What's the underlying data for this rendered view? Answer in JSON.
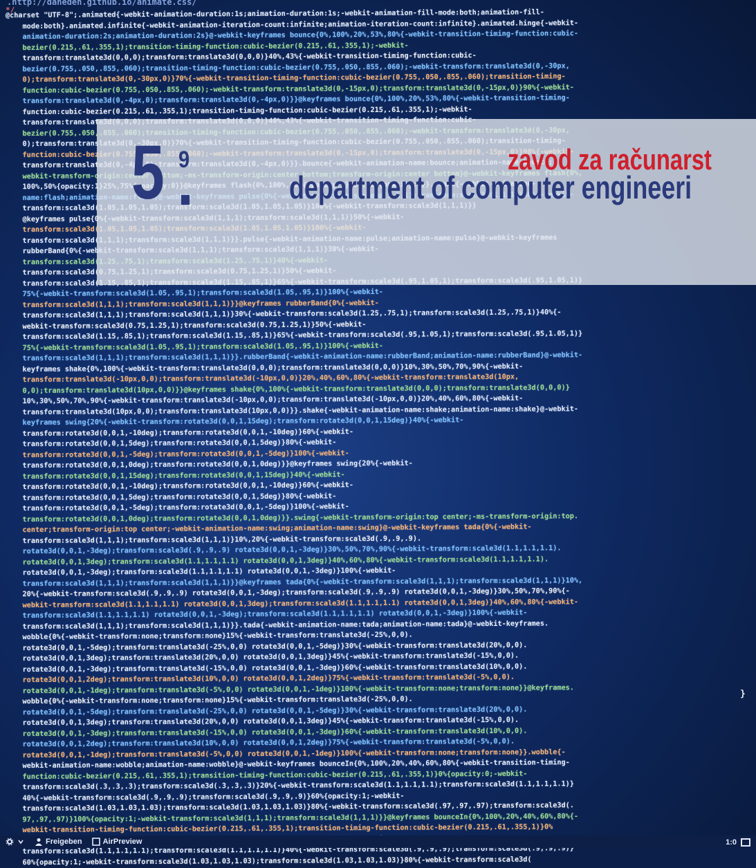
{
  "url_line": ".http://daneden.github.io/animate.css/",
  "comment_end": "*/",
  "code_lines": [
    "@charset \"UTF-8\";.animated{-webkit-animation-duration:1s;animation-duration:1s;-webkit-animation-fill-mode:both;animation-fill-",
    "    mode:both}.animated.infinite{-webkit-animation-iteration-count:infinite;animation-iteration-count:infinite}.animated.hinge{-webkit-",
    "    animation-duration:2s;animation-duration:2s}@-webkit-keyframes bounce{0%,100%,20%,53%,80%{-webkit-transition-timing-function:cubic-",
    "    bezier(0.215,.61,.355,1);transition-timing-function:cubic-bezier(0.215,.61,.355,1);-webkit-",
    "    transform:translate3d(0,0,0);transform:translate3d(0,0,0)}40%,43%{-webkit-transition-timing-function:cubic-",
    "    bezier(0.755,.050,.855,.060);transition-timing-function:cubic-bezier(0.755,.050,.855,.060);-webkit-transform:translate3d(0,-30px,",
    "    0);transform:translate3d(0,-30px,0)}70%{-webkit-transition-timing-function:cubic-bezier(0.755,.050,.855,.060);transition-timing-",
    "    function:cubic-bezier(0.755,.050,.855,.060);-webkit-transform:translate3d(0,-15px,0);transform:translate3d(0,-15px,0)}90%{-webkit-",
    "    transform:translate3d(0,-4px,0);transform:translate3d(0,-4px,0)}}@keyframes bounce{0%,100%,20%,53%,80%{-webkit-transition-timing-",
    "    function:cubic-bezier(0.215,.61,.355,1);transition-timing-function:cubic-bezier(0.215,.61,.355,1);-webkit-",
    "    transform:translate3d(0,0,0);transform:translate3d(0,0,0)}40%,43%{-webkit-transition-timing-function:cubic-",
    "    bezier(0.755,.050,.855,.060);transition-timing-function:cubic-bezier(0.755,.050,.855,.060);-webkit-transform:translate3d(0,-30px,",
    "    0);transform:translate3d(0,-30px,0)}70%{-webkit-transition-timing-function:cubic-bezier(0.755,.050,.855,.060);transition-timing-",
    "    function:cubic-bezier(0.755,.050,.855,.060);-webkit-transform:translate3d(0,-15px,0);transform:translate3d(0,-15px,0)}90%{-webkit-",
    "    transform:translate3d(0,-4px,0);transform:translate3d(0,-4px,0)}}.bounce{-webkit-animation-name:bounce;animation-name:bounce;",
    "    webkit-transform-origin:center bottom;-ms-transform-origin:center bottom;transform-origin:center bottom}@-webkit-keyframes flash{0%,",
    "    100%,50%{opacity:1}25%,75%{opacity:0}}@keyframes flash{0%,100%,50%{opacity:1}25%,75%{opacity:0}}.flash{-webkit-animation-",
    "    name:flash;animation-name:flash}@-webkit-keyframes pulse{0%{-webkit-transform:scale3d(1,1,1);transform:scale3d(1,1,1)}50%{-webkit-",
    "    transform:scale3d(1.05,1.05,1.05);transform:scale3d(1.05,1.05,1.05)}100%{-webkit-transform:scale3d(1,1,1)}}",
    "    @keyframes pulse{0%{-webkit-transform:scale3d(1,1,1);transform:scale3d(1,1,1)}50%{-webkit-",
    "    transform:scale3d(1.05,1.05,1.05);transform:scale3d(1.05,1.05,1.05)}100%{-webkit-",
    "    transform:scale3d(1,1,1);transform:scale3d(1,1,1)}}.pulse{-webkit-animation-name:pulse;animation-name:pulse}@-webkit-keyframes",
    "    rubberBand{0%{-webkit-transform:scale3d(1,1,1);transform:scale3d(1,1,1)}30%{-webkit-",
    "    transform:scale3d(1.25,.75,1);transform:scale3d(1.25,.75,1)}40%{-webkit-",
    "    transform:scale3d(0.75,1.25,1);transform:scale3d(0.75,1.25,1)}50%{-webkit-",
    "    transform:scale3d(1.15,.85,1);transform:scale3d(1.15,.85,1)}65%{-webkit-transform:scale3d(.95,1.05,1);transform:scale3d(.95,1.05,1)}",
    "    75%{-webkit-transform:scale3d(1.05,.95,1);transform:scale3d(1.05,.95,1)}100%{-webkit-",
    "    transform:scale3d(1,1,1);transform:scale3d(1,1,1)}}@keyframes rubberBand{0%{-webkit-",
    "    transform:scale3d(1,1,1);transform:scale3d(1,1,1)}30%{-webkit-transform:scale3d(1.25,.75,1);transform:scale3d(1.25,.75,1)}40%{-",
    "    webkit-transform:scale3d(0.75,1.25,1);transform:scale3d(0.75,1.25,1)}50%{-webkit-",
    "    transform:scale3d(1.15,.85,1);transform:scale3d(1.15,.85,1)}65%{-webkit-transform:scale3d(.95,1.05,1);transform:scale3d(.95,1.05,1)}",
    "    75%{-webkit-transform:scale3d(1.05,.95,1);transform:scale3d(1.05,.95,1)}100%{-webkit-",
    "    transform:scale3d(1,1,1);transform:scale3d(1,1,1)}}.rubberBand{-webkit-animation-name:rubberBand;animation-name:rubberBand}@-webkit-",
    "    keyframes shake{0%,100%{-webkit-transform:translate3d(0,0,0);transform:translate3d(0,0,0)}10%,30%,50%,70%,90%{-webkit-",
    "    transform:translate3d(-10px,0,0);transform:translate3d(-10px,0,0)}20%,40%,60%,80%{-webkit-transform:translate3d(10px,",
    "    0,0);transform:translate3d(10px,0,0)}}@keyframes shake{0%,100%{-webkit-transform:translate3d(0,0,0);transform:translate3d(0,0,0)}",
    "    10%,30%,50%,70%,90%{-webkit-transform:translate3d(-10px,0,0);transform:translate3d(-10px,0,0)}20%,40%,60%,80%{-webkit-",
    "    transform:translate3d(10px,0,0);transform:translate3d(10px,0,0)}}.shake{-webkit-animation-name:shake;animation-name:shake}@-webkit-",
    "    keyframes swing{20%{-webkit-transform:rotate3d(0,0,1,15deg);transform:rotate3d(0,0,1,15deg)}40%{-webkit-",
    "    transform:rotate3d(0,0,1,-10deg);transform:rotate3d(0,0,1,-10deg)}60%{-webkit-",
    "    transform:rotate3d(0,0,1,5deg);transform:rotate3d(0,0,1,5deg)}80%{-webkit-",
    "    transform:rotate3d(0,0,1,-5deg);transform:rotate3d(0,0,1,-5deg)}100%{-webkit-",
    "    transform:rotate3d(0,0,1,0deg);transform:rotate3d(0,0,1,0deg)}}@keyframes swing{20%{-webkit-",
    "    transform:rotate3d(0,0,1,15deg);transform:rotate3d(0,0,1,15deg)}40%{-webkit-",
    "    transform:rotate3d(0,0,1,-10deg);transform:rotate3d(0,0,1,-10deg)}60%{-webkit-",
    "    transform:rotate3d(0,0,1,5deg);transform:rotate3d(0,0,1,5deg)}80%{-webkit-",
    "    transform:rotate3d(0,0,1,-5deg);transform:rotate3d(0,0,1,-5deg)}100%{-webkit-",
    "    transform:rotate3d(0,0,1,0deg);transform:rotate3d(0,0,1,0deg)}}.swing{-webkit-transform-origin:top center;-ms-transform-origin:top.",
    "    center;transform-origin:top center;-webkit-animation-name:swing;animation-name:swing}@-webkit-keyframes tada{0%{-webkit-",
    "    transform:scale3d(1,1,1);transform:scale3d(1,1,1)}10%,20%{-webkit-transform:scale3d(.9,.9,.9).",
    "    rotate3d(0,0,1,-3deg);transform:scale3d(.9,.9,.9) rotate3d(0,0,1,-3deg)}30%,50%,70%,90%{-webkit-transform:scale3d(1.1,1.1,1.1).",
    "    rotate3d(0,0,1,3deg);transform:scale3d(1.1,1.1,1.1) rotate3d(0,0,1,3deg)}40%,60%,80%{-webkit-transform:scale3d(1.1,1.1,1.1).",
    "    rotate3d(0,0,1,-3deg);transform:scale3d(1.1,1.1,1.1) rotate3d(0,0,1,-3deg)}100%{-webkit-",
    "    transform:scale3d(1,1,1);transform:scale3d(1,1,1)}}@keyframes tada{0%{-webkit-transform:scale3d(1,1,1);transform:scale3d(1,1,1)}10%,",
    "    20%{-webkit-transform:scale3d(.9,.9,.9) rotate3d(0,0,1,-3deg);transform:scale3d(.9,.9,.9) rotate3d(0,0,1,-3deg)}30%,50%,70%,90%{-",
    "    webkit-transform:scale3d(1.1,1.1,1.1) rotate3d(0,0,1,3deg);transform:scale3d(1.1,1.1,1.1) rotate3d(0,0,1,3deg)}40%,60%,80%{-webkit-",
    "    transform:scale3d(1.1,1.1,1.1) rotate3d(0,0,1,-3deg);transform:scale3d(1.1,1.1,1.1) rotate3d(0,0,1,-3deg)}100%{-webkit-",
    "    transform:scale3d(1,1,1);transform:scale3d(1,1,1)}}.tada{-webkit-animation-name:tada;animation-name:tada}@-webkit-keyframes.",
    "    wobble{0%{-webkit-transform:none;transform:none}15%{-webkit-transform:translate3d(-25%,0,0).",
    "    rotate3d(0,0,1,-5deg);transform:translate3d(-25%,0,0) rotate3d(0,0,1,-5deg)}30%{-webkit-transform:translate3d(20%,0,0).",
    "    rotate3d(0,0,1,3deg);transform:translate3d(20%,0,0) rotate3d(0,0,1,3deg)}45%{-webkit-transform:translate3d(-15%,0,0).",
    "    rotate3d(0,0,1,-3deg);transform:translate3d(-15%,0,0) rotate3d(0,0,1,-3deg)}60%{-webkit-transform:translate3d(10%,0,0).",
    "    rotate3d(0,0,1,2deg);transform:translate3d(10%,0,0) rotate3d(0,0,1,2deg)}75%{-webkit-transform:translate3d(-5%,0,0).",
    "    rotate3d(0,0,1,-1deg);transform:translate3d(-5%,0,0) rotate3d(0,0,1,-1deg)}100%{-webkit-transform:none;transform:none}}@keyframes.",
    "    wobble{0%{-webkit-transform:none;transform:none}15%{-webkit-transform:translate3d(-25%,0,0).",
    "    rotate3d(0,0,1,-5deg);transform:translate3d(-25%,0,0) rotate3d(0,0,1,-5deg)}30%{-webkit-transform:translate3d(20%,0,0).",
    "    rotate3d(0,0,1,3deg);transform:translate3d(20%,0,0) rotate3d(0,0,1,3deg)}45%{-webkit-transform:translate3d(-15%,0,0).",
    "    rotate3d(0,0,1,-3deg);transform:translate3d(-15%,0,0) rotate3d(0,0,1,-3deg)}60%{-webkit-transform:translate3d(10%,0,0).",
    "    rotate3d(0,0,1,2deg);transform:translate3d(10%,0,0) rotate3d(0,0,1,2deg)}75%{-webkit-transform:translate3d(-5%,0,0).",
    "    rotate3d(0,0,1,-1deg);transform:translate3d(-5%,0,0) rotate3d(0,0,1,-1deg)}100%{-webkit-transform:none;transform:none}}.wobble{-",
    "    webkit-animation-name:wobble;animation-name:wobble}@-webkit-keyframes bounceIn{0%,100%,20%,40%,60%,80%{-webkit-transition-timing-",
    "    function:cubic-bezier(0.215,.61,.355,1);transition-timing-function:cubic-bezier(0.215,.61,.355,1)}0%{opacity:0;-webkit-",
    "    transform:scale3d(.3,.3,.3);transform:scale3d(.3,.3,.3)}20%{-webkit-transform:scale3d(1.1,1.1,1.1);transform:scale3d(1.1,1.1,1.1)}",
    "    40%{-webkit-transform:scale3d(.9,.9,.9);transform:scale3d(.9,.9,.9)}60%{opacity:1;-webkit-",
    "    transform:scale3d(1.03,1.03,1.03);transform:scale3d(1.03,1.03,1.03)}80%{-webkit-transform:scale3d(.97,.97,.97);transform:scale3d(.",
    "    97,.97,.97)}100%{opacity:1;-webkit-transform:scale3d(1,1,1);transform:scale3d(1,1,1)}}@keyframes bounceIn{0%,100%,20%,40%,60%,80%{-",
    "    webkit-transition-timing-function:cubic-bezier(0.215,.61,.355,1);transition-timing-function:cubic-bezier(0.215,.61,.355,1)}0%",
    "    {opacity:0;-webkit-transform:scale3d(.3,.3,.3);transform:scale3d(.3,.3,.3)}20%{-webkit-",
    "    transform:scale3d(1.1,1.1,1.1);transform:scale3d(1.1,1.1,1.1)}40%{-webkit-transform:scale3d(.9,.9,.9);transform:scale3d(.9,.9,.9)}",
    "    60%{opacity:1;-webkit-transform:scale3d(1.03,1.03,1.03);transform:scale3d(1.03,1.03,1.03)}80%{-webkit-transform:scale3d("
  ],
  "close_brace": "}",
  "banner": {
    "logo_digit": "5",
    "logo_superscript": "9",
    "institution_line1": "zavod za računarst",
    "institution_line2": "department of computer engineeri"
  },
  "status_bar": {
    "item1_label": "Freigeben",
    "item2_label": "AirPreview",
    "zoom_label": "1:0"
  },
  "colors": {
    "logo_navy": "#2a3a7c",
    "institution_red": "#cf1f2c",
    "screen_blue": "#0f2a63"
  }
}
